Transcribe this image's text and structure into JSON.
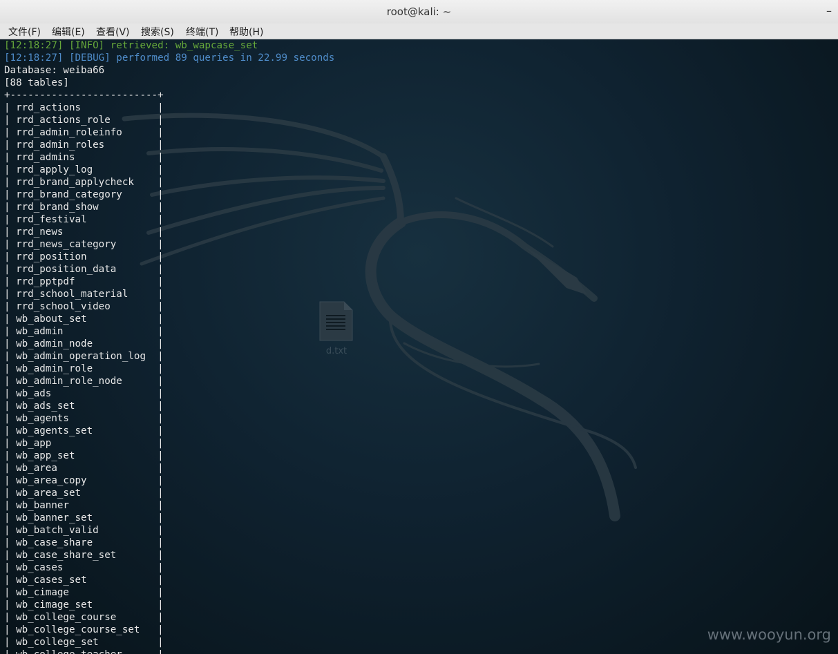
{
  "window": {
    "title": "root@kali: ~",
    "minimize_label": "–"
  },
  "menu": [
    "文件(F)",
    "编辑(E)",
    "查看(V)",
    "搜索(S)",
    "终端(T)",
    "帮助(H)"
  ],
  "terminal": {
    "info_line": "[12:18:27] [INFO] retrieved: wb_wapcase_set",
    "debug_line": "[12:18:27] [DEBUG] performed 89 queries in 22.99 seconds",
    "database_line": "Database: weiba66",
    "count_line": "[88 tables]",
    "border_line": "+-------------------------+",
    "tables": [
      "rrd_actions",
      "rrd_actions_role",
      "rrd_admin_roleinfo",
      "rrd_admin_roles",
      "rrd_admins",
      "rrd_apply_log",
      "rrd_brand_applycheck",
      "rrd_brand_category",
      "rrd_brand_show",
      "rrd_festival",
      "rrd_news",
      "rrd_news_category",
      "rrd_position",
      "rrd_position_data",
      "rrd_pptpdf",
      "rrd_school_material",
      "rrd_school_video",
      "wb_about_set",
      "wb_admin",
      "wb_admin_node",
      "wb_admin_operation_log",
      "wb_admin_role",
      "wb_admin_role_node",
      "wb_ads",
      "wb_ads_set",
      "wb_agents",
      "wb_agents_set",
      "wb_app",
      "wb_app_set",
      "wb_area",
      "wb_area_copy",
      "wb_area_set",
      "wb_banner",
      "wb_banner_set",
      "wb_batch_valid",
      "wb_case_share",
      "wb_case_share_set",
      "wb_cases",
      "wb_cases_set",
      "wb_cimage",
      "wb_cimage_set",
      "wb_college_course",
      "wb_college_course_set",
      "wb_college_set",
      "wb_college_teacher"
    ]
  },
  "desktop": {
    "file_label": "d.txt",
    "file_icon": "text-file-icon",
    "watermark": "www.wooyun.org"
  },
  "colors": {
    "info": "#66a83a",
    "debug": "#4f8cc9",
    "text": "#e8e8e8"
  }
}
